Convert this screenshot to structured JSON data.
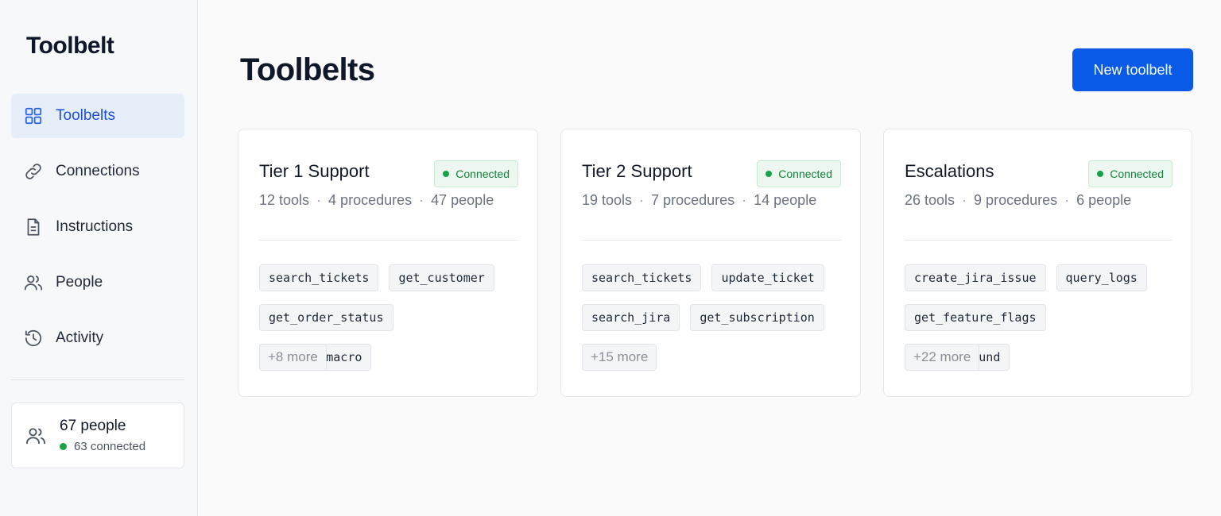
{
  "brand": "Toolbelt",
  "nav": {
    "items": [
      {
        "label": "Toolbelts",
        "icon": "grid-icon"
      },
      {
        "label": "Connections",
        "icon": "link-icon"
      },
      {
        "label": "Instructions",
        "icon": "document-icon"
      },
      {
        "label": "People",
        "icon": "people-icon"
      },
      {
        "label": "Activity",
        "icon": "history-icon"
      }
    ],
    "active": "Toolbelts"
  },
  "people_summary": {
    "count": "67 people",
    "status": "63 connected"
  },
  "header": {
    "title": "Toolbelts",
    "new_button": "New toolbelt"
  },
  "cards": [
    {
      "title": "Tier 1 Support",
      "badge": "Connected",
      "tools": "12 tools",
      "procedures": "4 procedures",
      "people": "47 people",
      "tags": [
        "search_tickets",
        "get_customer",
        "get_order_status",
        "suggest_macro"
      ],
      "more": "+8 more"
    },
    {
      "title": "Tier 2 Support",
      "badge": "Connected",
      "tools": "19 tools",
      "procedures": "7 procedures",
      "people": "14 people",
      "tags": [
        "search_tickets",
        "update_ticket",
        "search_jira",
        "get_subscription"
      ],
      "more": "+15 more"
    },
    {
      "title": "Escalations",
      "badge": "Connected",
      "tools": "26 tools",
      "procedures": "9 procedures",
      "people": "6 people",
      "tags": [
        "create_jira_issue",
        "query_logs",
        "get_feature_flags",
        "issue_refund"
      ],
      "more": "+22 more"
    }
  ],
  "colors": {
    "accent": "#0a5ae8",
    "connected": "#16a34a",
    "active_nav_bg": "#e6eef9"
  }
}
